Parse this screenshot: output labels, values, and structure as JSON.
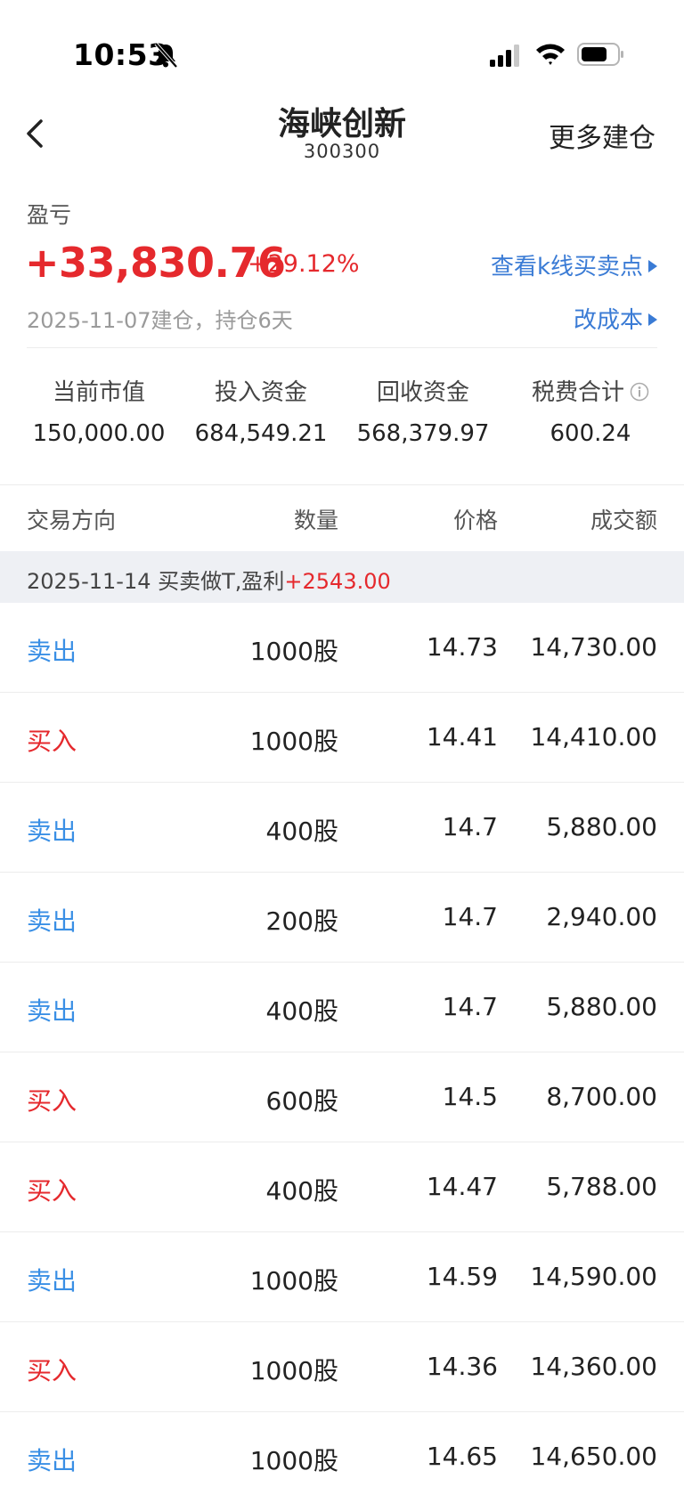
{
  "status_bar": {
    "time": "10:53"
  },
  "nav": {
    "title": "海峡创新",
    "code": "300300",
    "more_label": "更多建仓"
  },
  "pnl": {
    "label": "盈亏",
    "value": "+33,830.76",
    "pct": "+29.12%",
    "kline_link": "查看k线买卖点",
    "build_info": "2025-11-07建仓，持仓6天",
    "cost_link": "改成本"
  },
  "stats": [
    {
      "label": "当前市值",
      "value": "150,000.00"
    },
    {
      "label": "投入资金",
      "value": "684,549.21"
    },
    {
      "label": "回收资金",
      "value": "568,379.97"
    },
    {
      "label": "税费合计",
      "value": "600.24"
    }
  ],
  "table": {
    "headers": {
      "direction": "交易方向",
      "qty": "数量",
      "price": "价格",
      "amount": "成交额"
    },
    "group": {
      "date_desc": "2025-11-14 买卖做T,盈利",
      "profit": "+2543.00"
    },
    "rows": [
      {
        "dir": "卖出",
        "type": "sell",
        "qty": "1000股",
        "price": "14.73",
        "amount": "14,730.00"
      },
      {
        "dir": "买入",
        "type": "buy",
        "qty": "1000股",
        "price": "14.41",
        "amount": "14,410.00"
      },
      {
        "dir": "卖出",
        "type": "sell",
        "qty": "400股",
        "price": "14.7",
        "amount": "5,880.00"
      },
      {
        "dir": "卖出",
        "type": "sell",
        "qty": "200股",
        "price": "14.7",
        "amount": "2,940.00"
      },
      {
        "dir": "卖出",
        "type": "sell",
        "qty": "400股",
        "price": "14.7",
        "amount": "5,880.00"
      },
      {
        "dir": "买入",
        "type": "buy",
        "qty": "600股",
        "price": "14.5",
        "amount": "8,700.00"
      },
      {
        "dir": "买入",
        "type": "buy",
        "qty": "400股",
        "price": "14.47",
        "amount": "5,788.00"
      },
      {
        "dir": "卖出",
        "type": "sell",
        "qty": "1000股",
        "price": "14.59",
        "amount": "14,590.00"
      },
      {
        "dir": "买入",
        "type": "buy",
        "qty": "1000股",
        "price": "14.36",
        "amount": "14,360.00"
      },
      {
        "dir": "卖出",
        "type": "sell",
        "qty": "1000股",
        "price": "14.65",
        "amount": "14,650.00"
      }
    ]
  },
  "colors": {
    "up": "#e5292d",
    "sell": "#3a8fe5",
    "link": "#3a7bd5"
  }
}
